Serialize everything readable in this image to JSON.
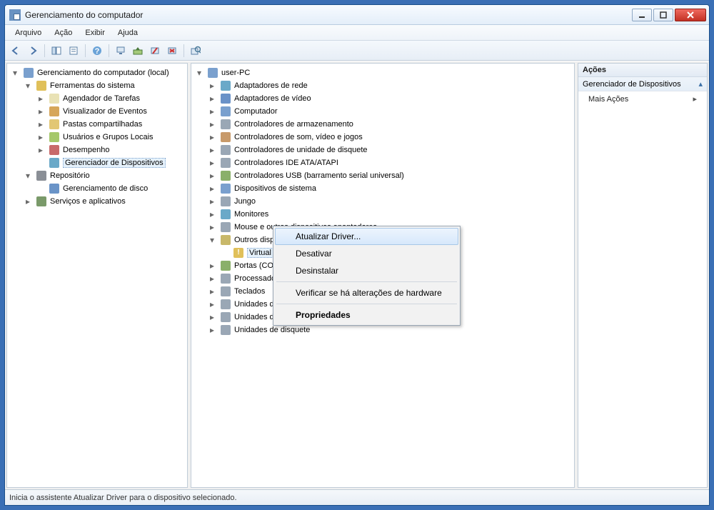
{
  "window": {
    "title": "Gerenciamento do computador"
  },
  "menu": {
    "file": "Arquivo",
    "action": "Ação",
    "view": "Exibir",
    "help": "Ajuda"
  },
  "left_tree": {
    "root": "Gerenciamento do computador (local)",
    "system_tools": "Ferramentas do sistema",
    "scheduler": "Agendador de Tarefas",
    "event_viewer": "Visualizador de Eventos",
    "shared_folders": "Pastas compartilhadas",
    "users_groups": "Usuários e Grupos Locais",
    "performance": "Desempenho",
    "device_manager": "Gerenciador de Dispositivos",
    "storage": "Repositório",
    "disk_mgmt": "Gerenciamento de disco",
    "services": "Serviços e aplicativos"
  },
  "device_tree": {
    "root": "user-PC",
    "net": "Adaptadores de rede",
    "vid": "Adaptadores de vídeo",
    "comp": "Computador",
    "stor": "Controladores de armazenamento",
    "snd": "Controladores de som, vídeo e jogos",
    "flop": "Controladores de unidade de disquete",
    "ide": "Controladores IDE ATA/ATAPI",
    "usb": "Controladores USB (barramento serial universal)",
    "sys": "Dispositivos de sistema",
    "jungo": "Jungo",
    "mon": "Monitores",
    "mouse": "Mouse e outros dispositivos apontadores",
    "other": "Outros dispositivos",
    "other_item": "Virtual ComPort",
    "ports": "Portas (COM e LPT)",
    "cpu": "Processadores",
    "kbd": "Teclados",
    "dvd": "Unidades de DVD/CD-ROM",
    "hdd": "Unidades de disco",
    "fdd": "Unidades de disquete"
  },
  "context_menu": {
    "update": "Atualizar Driver...",
    "disable": "Desativar",
    "uninstall": "Desinstalar",
    "scan": "Verificar se há alterações de hardware",
    "props": "Propriedades"
  },
  "actions": {
    "title": "Ações",
    "section": "Gerenciador de Dispositivos",
    "more": "Mais Ações"
  },
  "status": "Inicia o assistente Atualizar Driver para o dispositivo selecionado."
}
